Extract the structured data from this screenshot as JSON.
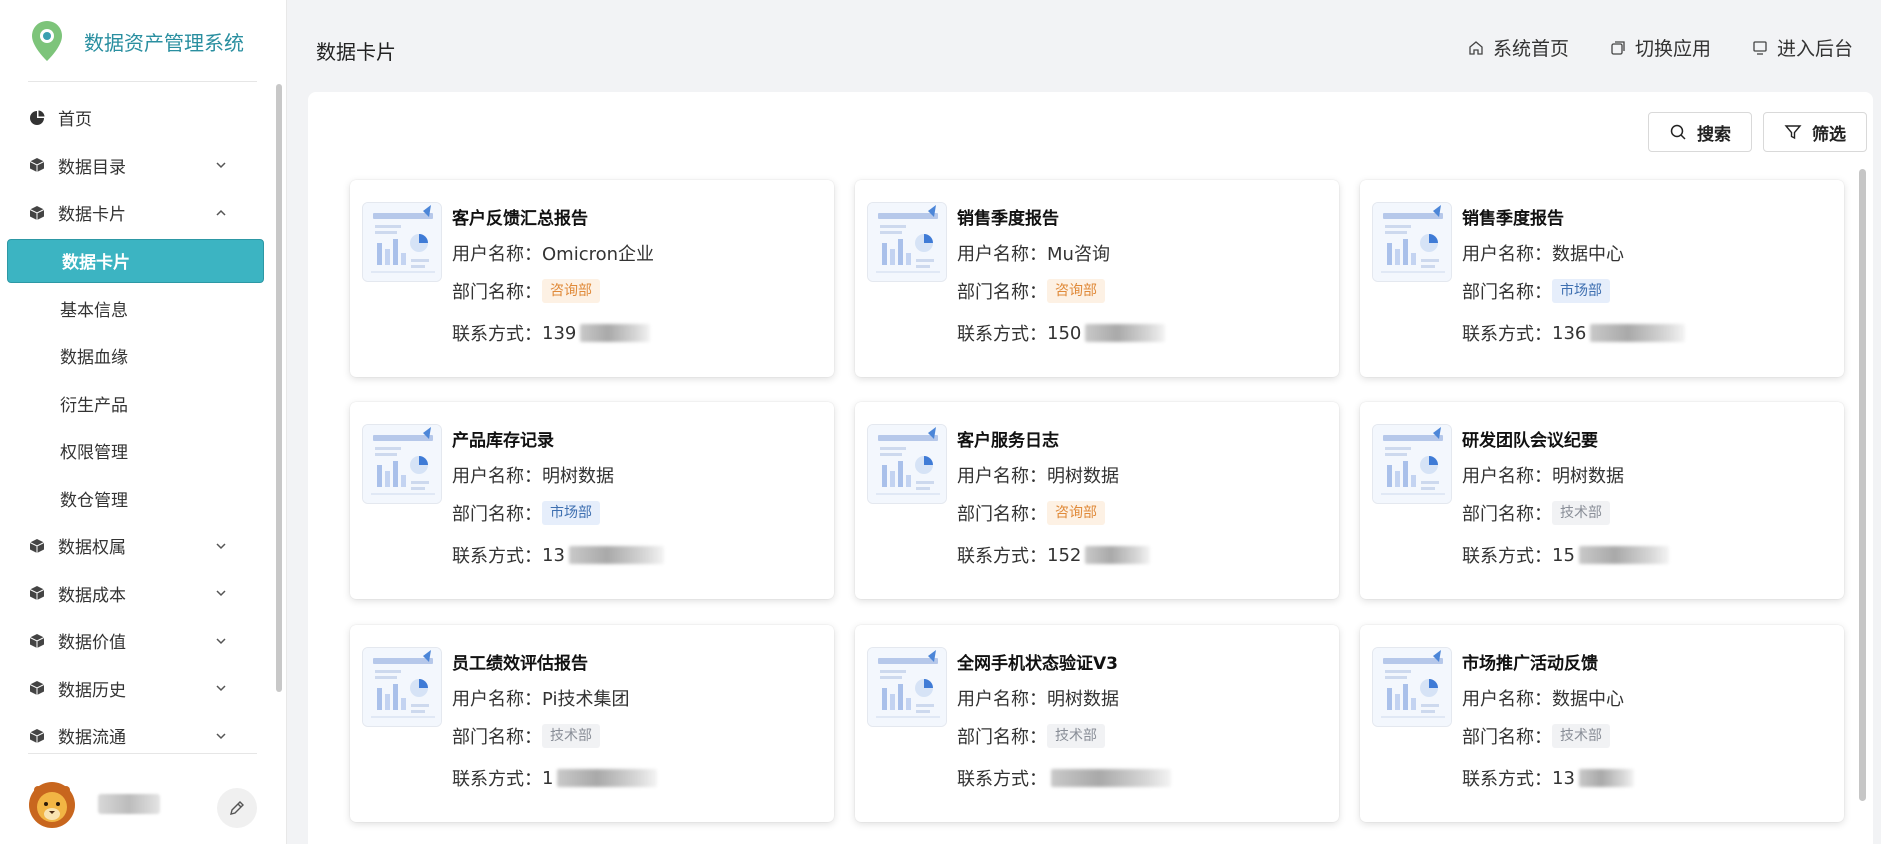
{
  "brand": {
    "title": "数据资产管理系统",
    "color": "#2a8fa0"
  },
  "nav": {
    "items": [
      {
        "label": "首页",
        "icon": "pie-chart-icon",
        "expandable": false
      },
      {
        "label": "数据目录",
        "icon": "cube-icon",
        "expandable": true,
        "expanded": false
      },
      {
        "label": "数据卡片",
        "icon": "cube-icon",
        "expandable": true,
        "expanded": true
      }
    ],
    "sub_items": [
      {
        "label": "数据卡片",
        "active": true
      },
      {
        "label": "基本信息"
      },
      {
        "label": "数据血缘"
      },
      {
        "label": "衍生产品"
      },
      {
        "label": "权限管理"
      },
      {
        "label": "数仓管理"
      }
    ],
    "more_items": [
      {
        "label": "数据权属",
        "icon": "cube-icon"
      },
      {
        "label": "数据成本",
        "icon": "cube-icon"
      },
      {
        "label": "数据价值",
        "icon": "cube-icon"
      },
      {
        "label": "数据历史",
        "icon": "cube-icon"
      },
      {
        "label": "数据流通",
        "icon": "cube-icon"
      }
    ]
  },
  "user": {
    "avatar": "lion-avatar",
    "edit_icon": "pencil-icon"
  },
  "header": {
    "title": "数据卡片",
    "actions": [
      {
        "label": "系统首页",
        "icon": "home-icon"
      },
      {
        "label": "切换应用",
        "icon": "switch-app-icon"
      },
      {
        "label": "进入后台",
        "icon": "monitor-icon"
      }
    ]
  },
  "toolbar": {
    "search_label": "搜索",
    "filter_label": "筛选"
  },
  "labels": {
    "user": "用户名称：",
    "dept": "部门名称：",
    "contact": "联系方式："
  },
  "accent": "#3cb4c2",
  "cards": [
    {
      "title": "客户反馈汇总报告",
      "user": "Omicron企业",
      "dept": "咨询部",
      "dept_color": "orange",
      "contact_visible": "139"
    },
    {
      "title": "销售季度报告",
      "user": "Mu咨询",
      "dept": "咨询部",
      "dept_color": "orange",
      "contact_visible": "150"
    },
    {
      "title": "销售季度报告",
      "user": "数据中心",
      "dept": "市场部",
      "dept_color": "blue",
      "contact_visible": "136"
    },
    {
      "title": "产品库存记录",
      "user": "明树数据",
      "dept": "市场部",
      "dept_color": "blue",
      "contact_visible": "13"
    },
    {
      "title": "客户服务日志",
      "user": "明树数据",
      "dept": "咨询部",
      "dept_color": "orange",
      "contact_visible": "152"
    },
    {
      "title": "研发团队会议纪要",
      "user": "明树数据",
      "dept": "技术部",
      "dept_color": "gray",
      "contact_visible": "15"
    },
    {
      "title": "员工绩效评估报告",
      "user": "Pi技术集团",
      "dept": "技术部",
      "dept_color": "gray",
      "contact_visible": "1"
    },
    {
      "title": "全网手机状态验证V3",
      "user": "明树数据",
      "dept": "技术部",
      "dept_color": "gray",
      "contact_visible": ""
    },
    {
      "title": "市场推广活动反馈",
      "user": "数据中心",
      "dept": "技术部",
      "dept_color": "gray",
      "contact_visible": "13"
    }
  ]
}
